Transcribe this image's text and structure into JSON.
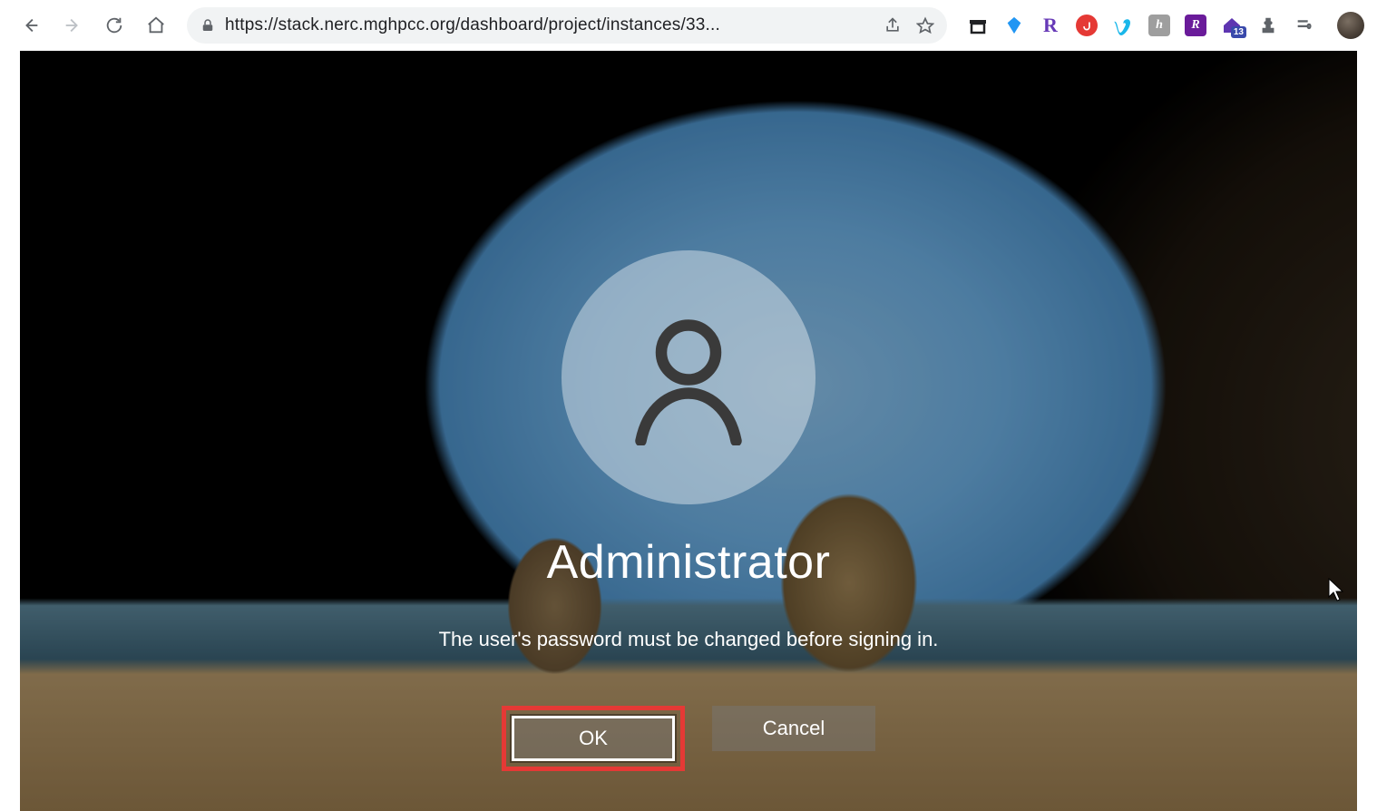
{
  "browser": {
    "url_display": "https://stack.nerc.mghpcc.org/dashboard/project/instances/33...",
    "share_label": "Share",
    "bookmark_label": "Bookmark"
  },
  "extensions": {
    "box_icon": "box",
    "diamond_icon": "diamond-blue",
    "rakuten_icon": "R",
    "opera_icon": "u",
    "vimeo_icon": "v",
    "h_icon": "h",
    "purple_icon": "R",
    "house_icon": "home",
    "house_badge": "13",
    "puzzle_icon": "puzzle",
    "eq_icon": "equalizer"
  },
  "login": {
    "username": "Administrator",
    "message": "The user's password must be changed before signing in.",
    "ok_label": "OK",
    "cancel_label": "Cancel"
  }
}
